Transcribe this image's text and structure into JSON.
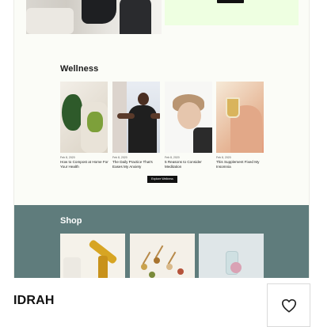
{
  "site_name": "IDRAH",
  "favorite_icon": "heart-outline-icon",
  "preview": {
    "wellness": {
      "title": "Wellness",
      "articles": [
        {
          "date": "Feb 8, 2020",
          "title": "How to Compost at Home For Your Health"
        },
        {
          "date": "Feb 8, 2020",
          "title": "The Daily Practice That's Eases My Anxiety"
        },
        {
          "date": "Feb 8, 2020",
          "title": "5 Reasons to Consider Meditation"
        },
        {
          "date": "Feb 8, 2020",
          "title": "This Supplement Fixed My Insomnia"
        }
      ],
      "button": "Explore Wellness"
    },
    "shop": {
      "title": "Shop"
    }
  },
  "colors": {
    "shop_band": "#5f7c7c",
    "hero_accent": "#eeffe1",
    "page_bg": "#fbfcf7"
  }
}
